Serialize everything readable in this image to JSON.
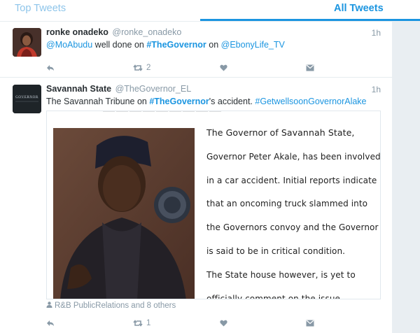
{
  "tabs": {
    "top": "Top Tweets",
    "all": "All Tweets"
  },
  "tweets": [
    {
      "name": "ronke onadeko",
      "handle": "@ronke_onadeko",
      "time": "1h",
      "text": {
        "mention": "@MoAbudu",
        "mid": " well done on ",
        "hashtag": "#TheGovernor",
        "on": " on ",
        "mention2": "@EbonyLife_TV"
      },
      "actions": {
        "retweets": "2"
      }
    },
    {
      "name": "Savannah State",
      "handle": "@TheGovernor_EL",
      "time": "1h",
      "avatar_text": "GOVERNOR",
      "text": {
        "pre": "The Savannah Tribune on ",
        "hashtag": "#TheGovernor",
        "post": "'s accident. ",
        "hashtag2": "#GetwellsoonGovernorAlake"
      },
      "card": {
        "lines": [
          "The Governor of Savannah State,",
          "Governor Peter Akale, has been involved",
          "in a car accident. Initial reports indicate",
          "that an oncoming truck slammed into",
          "the Governors convoy and the Governor",
          "is said to be in critical condition.",
          "The State house however, is yet to",
          "officially comment on the issue."
        ]
      },
      "tagged": "R&B PublicRelations and 8 others",
      "actions": {
        "retweets": "1"
      }
    }
  ],
  "colors": {
    "link": "#1b95e0",
    "muted": "#8899a6",
    "tab_inactive": "#8ec5ea"
  }
}
